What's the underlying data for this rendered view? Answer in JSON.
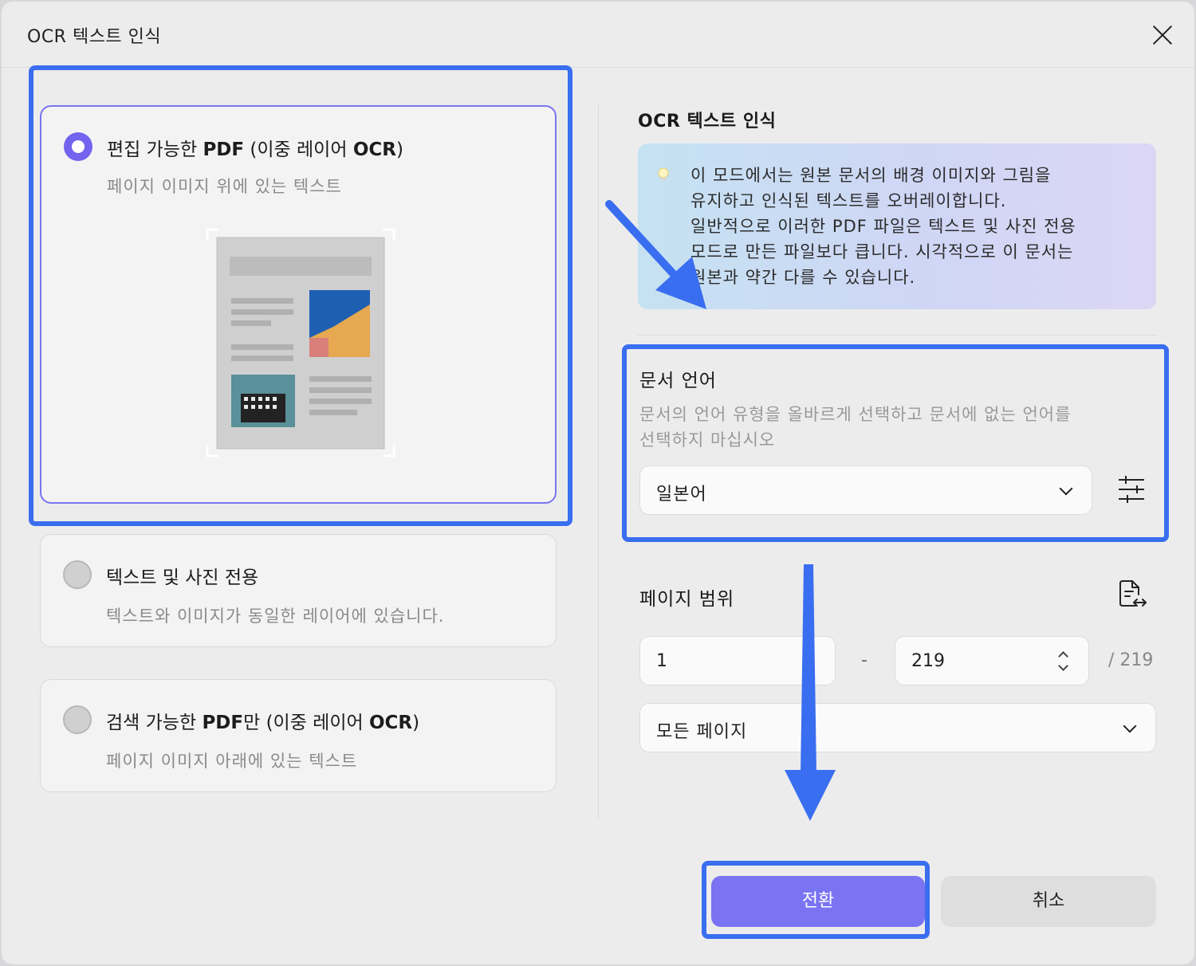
{
  "dialog": {
    "title": "OCR 텍스트 인식"
  },
  "modes": [
    {
      "title_pre": "편집 가능한 ",
      "title_bold": "PDF",
      "title_mid": " (이중 레이어 ",
      "title_bold2": "OCR",
      "title_end": ")",
      "desc": "페이지 이미지 위에 있는 텍스트",
      "selected": true
    },
    {
      "title_pre": "텍스트 및 사진 전용",
      "desc": "텍스트와 이미지가 동일한 레이어에 있습니다.",
      "selected": false
    },
    {
      "title_pre": "검색 가능한 ",
      "title_bold": "PDF",
      "title_mid": "만 (이중 레이어 ",
      "title_bold2": "OCR",
      "title_end": ")",
      "desc": "페이지 이미지 아래에 있는 텍스트",
      "selected": false
    }
  ],
  "panel": {
    "title": "OCR 텍스트 인식",
    "info_lines": [
      "이 모드에서는 원본 문서의 배경 이미지와 그림을",
      "유지하고 인식된 텍스트를 오버레이합니다.",
      "일반적으로 이러한 PDF 파일은 텍스트 및 사진 전용",
      "모드로 만든 파일보다 큽니다. 시각적으로 이 문서는",
      "원본과 약간 다를 수 있습니다."
    ],
    "language": {
      "label": "문서 언어",
      "desc_lines": [
        "문서의 언어 유형을 올바르게 선택하고 문서에 없는 언어를",
        "선택하지 마십시오"
      ],
      "value": "일본어"
    },
    "page_range": {
      "label": "페이지 범위",
      "from": "1",
      "dash": "-",
      "to": "219",
      "total": "/ 219",
      "subset": "모든 페이지"
    }
  },
  "buttons": {
    "convert": "전환",
    "cancel": "취소"
  },
  "colors": {
    "accent": "#7a74f2",
    "highlight": "#3a6ef0"
  }
}
